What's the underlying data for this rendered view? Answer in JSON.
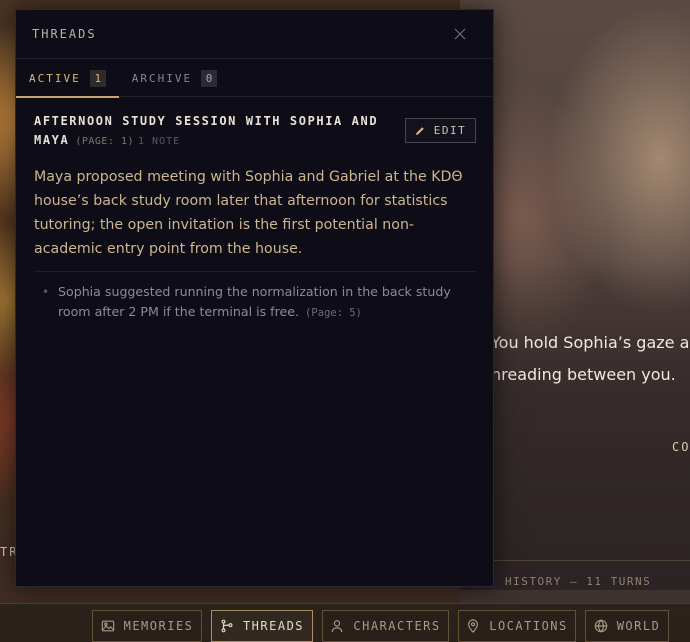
{
  "background": {
    "story_line_1": "You hold Sophia’s gaze a m",
    "story_line_2": "hreading between you.",
    "right_label": "CO",
    "left_label": "TR",
    "history_label": "HISTORY — 11 TURNS"
  },
  "panel": {
    "title": "THREADS",
    "close_icon": "close-icon",
    "tabs": [
      {
        "label": "ACTIVE",
        "count": "1",
        "active": true
      },
      {
        "label": "ARCHIVE",
        "count": "0",
        "active": false
      }
    ],
    "thread": {
      "title": "AFTERNOON STUDY SESSION WITH SOPHIA AND MAYA",
      "page": "(PAGE: 1)",
      "notes_count": "1 NOTE",
      "edit_label": "EDIT",
      "description": "Maya proposed meeting with Sophia and Gabriel at the KDΘ house’s back study room later that afternoon for statistics tutoring; the open invitation is the first potential non-academic entry point from the house.",
      "notes": [
        {
          "text": "Sophia suggested running the normalization in the back study room after 2 PM if the terminal is free.",
          "ref": "(Page: 5)"
        }
      ]
    }
  },
  "bottom_nav": [
    {
      "label": "MEMORIES",
      "icon": "image-icon",
      "active": false
    },
    {
      "label": "THREADS",
      "icon": "branch-icon",
      "active": true
    },
    {
      "label": "CHARACTERS",
      "icon": "person-icon",
      "active": false
    },
    {
      "label": "LOCATIONS",
      "icon": "pin-icon",
      "active": false
    },
    {
      "label": "WORLD",
      "icon": "globe-icon",
      "active": false
    }
  ],
  "colors": {
    "panel_bg": "#0e0c17",
    "accent_gold": "#d9b676",
    "description_text": "#cdb690"
  }
}
